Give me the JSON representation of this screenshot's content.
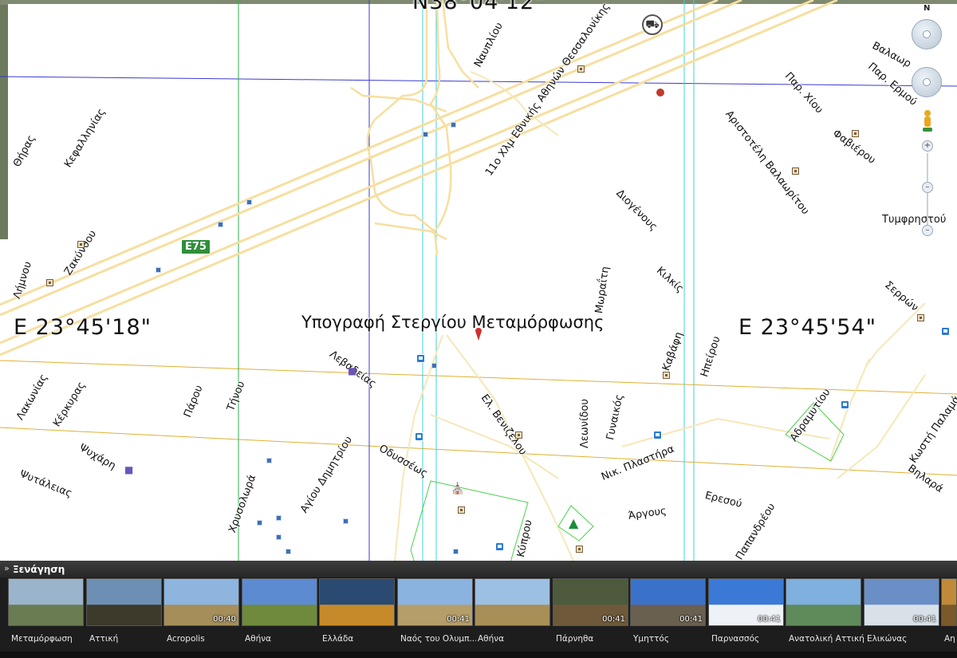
{
  "map": {
    "top_coord": "N38°04'12\"",
    "left_coord": "E 23°45'18\"",
    "right_coord": "E 23°45'54\"",
    "place_title": "Υπογραφή Στεργίου Μεταμόρφωσης",
    "highway_shield": "E75",
    "streets": {
      "nafplio": "Ναυπλίου",
      "ethniki": "11ο Χλμ Εθνικής Αθηνών Θεσσαλονίκης",
      "thiras": "Θήρας",
      "kefallinias": "Κεφαλληνίας",
      "zakynthou": "Ζακύνθου",
      "limnou": "Λήμνου",
      "lakonias": "Λακωνίας",
      "kerkyras": "Κέρκυρας",
      "parou": "Πάρου",
      "tinou": "Τήνου",
      "lebadeias": "Λεβαδείας",
      "psychari": "Ψυχάρη",
      "psyttaleias": "Ψυτάλειας",
      "chrysoloras": "Χρυσολωρά",
      "agiou_dimitriou": "Αγίου Δημητρίου",
      "odysseos": "Οδυσσέως",
      "el_venizelou": "Ελ. Βενιζέλου",
      "leonidou": "Λεωνίδου",
      "gynaikos": "Γυναικός",
      "kavafi": "Καβάφη",
      "ithakis": "Ηπείρου",
      "plastira": "Νικ. Πλαστήρα",
      "argous": "Άργους",
      "eressou": "Ερεσού",
      "papandreou": "Παπανδρέου",
      "kyprou": "Κύπρου",
      "moraiti": "Μωραΐτη",
      "diogenous": "Διογένους",
      "kilkis": "Κιλκίς",
      "aristoteli": "Αριστοτέλη Βαλαωρίτου",
      "par_chios": "Παρ. Χίου",
      "par_ermou": "Παρ. Ερμού",
      "valaori": "Βαλαωρ",
      "fabierou": "Φαβιέρου",
      "tymfristou": "Τυμφρηστού",
      "serron": "Σερρών",
      "adramytiou": "Αδραμυτίου",
      "kostis_palamas": "Κωστή Παλαμά",
      "vilara": "Βηλαρά"
    }
  },
  "navigation": {
    "north": "N"
  },
  "tour": {
    "title": "Ξενάγηση",
    "items": [
      {
        "label": "Μεταμόρφωση",
        "duration": "",
        "sky": "#9ab4cc",
        "ground": "#6a7c52"
      },
      {
        "label": "Αττική",
        "duration": "",
        "sky": "#6d8fb3",
        "ground": "#3d3a2c"
      },
      {
        "label": "Acropolis",
        "duration": "00:40",
        "sky": "#8db5de",
        "ground": "#a58e5a"
      },
      {
        "label": "Αθήνα",
        "duration": "",
        "sky": "#5c8bd1",
        "ground": "#6f8a3c"
      },
      {
        "label": "Ελλάδα",
        "duration": "",
        "sky": "#2a4a72",
        "ground": "#c68a2a"
      },
      {
        "label": "Ναός του Ολυμπ...",
        "duration": "00:41",
        "sky": "#8ab3e0",
        "ground": "#b59e6a"
      },
      {
        "label": "Αθήνα",
        "duration": "",
        "sky": "#9cc0e2",
        "ground": "#a88f58"
      },
      {
        "label": "Πάρνηθα",
        "duration": "00:41",
        "sky": "#4d5a3c",
        "ground": "#6e5a3a"
      },
      {
        "label": "Υμηττός",
        "duration": "00:41",
        "sky": "#3b72c9",
        "ground": "#6a6050"
      },
      {
        "label": "Παρνασσός",
        "duration": "00:41",
        "sky": "#3a7ad6",
        "ground": "#eef2f6"
      },
      {
        "label": "Ανατολική Αττική",
        "duration": "",
        "sky": "#7fb0de",
        "ground": "#5f8a5a"
      },
      {
        "label": "Ελικώνας",
        "duration": "00:41",
        "sky": "#6a8fc6",
        "ground": "#d8e0e8"
      },
      {
        "label": "Αη",
        "duration": "",
        "sky": "#c08a3a",
        "ground": "#7a5a2a"
      }
    ]
  }
}
